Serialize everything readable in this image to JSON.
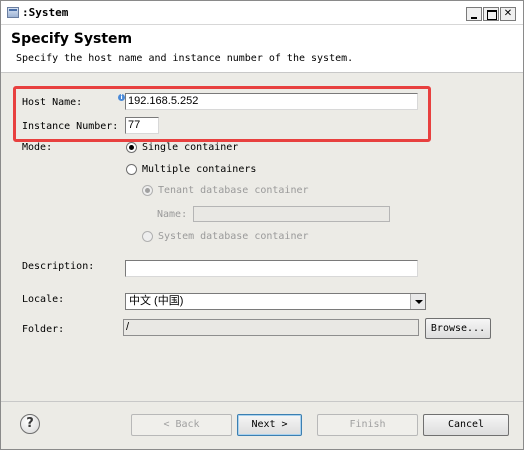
{
  "window": {
    "title": ":System"
  },
  "header": {
    "title": "Specify System",
    "description": "Specify the host name and instance number of the system."
  },
  "form": {
    "host_name_label": "Host Name:",
    "host_name_value": "192.168.5.252",
    "instance_number_label": "Instance Number:",
    "instance_number_value": "77",
    "mode_label": "Mode:",
    "mode_single": "Single container",
    "mode_multiple": "Multiple containers",
    "tenant_db": "Tenant database container",
    "name_label": "Name:",
    "name_value": "",
    "system_db": "System database container",
    "description_label": "Description:",
    "description_value": "",
    "locale_label": "Locale:",
    "locale_value": "中文 (中国)",
    "folder_label": "Folder:",
    "folder_value": "/",
    "browse_label": "Browse..."
  },
  "buttons": {
    "back": "< Back",
    "next": "Next >",
    "finish": "Finish",
    "cancel": "Cancel"
  },
  "colors": {
    "highlight": "#e8403f",
    "window_bg": "#ecebe6"
  }
}
